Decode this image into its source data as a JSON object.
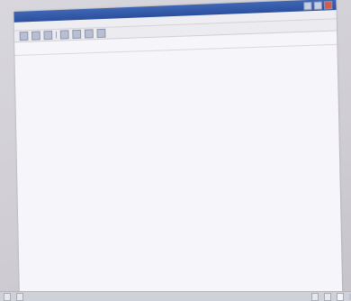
{
  "window": {
    "title": "",
    "title_right": ""
  },
  "menu": {
    "items": [
      "",
      "",
      "",
      "",
      "",
      ""
    ]
  },
  "header": {
    "rows": [
      {
        "label": "",
        "value": ""
      },
      {
        "label": "",
        "value": ""
      },
      {
        "label": "",
        "value": ""
      }
    ]
  },
  "body": {
    "lines": [
      "",
      "",
      "",
      "",
      "",
      "",
      "",
      "",
      ""
    ],
    "forwarded_lines": [
      "",
      "",
      ""
    ],
    "message_lines": [
      "",
      "",
      "",
      "",
      "",
      "",
      "",
      "",
      ""
    ],
    "signature_lines": [
      "",
      ""
    ],
    "footer_lines": [
      "",
      "",
      ""
    ]
  },
  "taskbar": {
    "items": [
      "",
      "",
      "",
      "",
      ""
    ],
    "clock": ""
  }
}
